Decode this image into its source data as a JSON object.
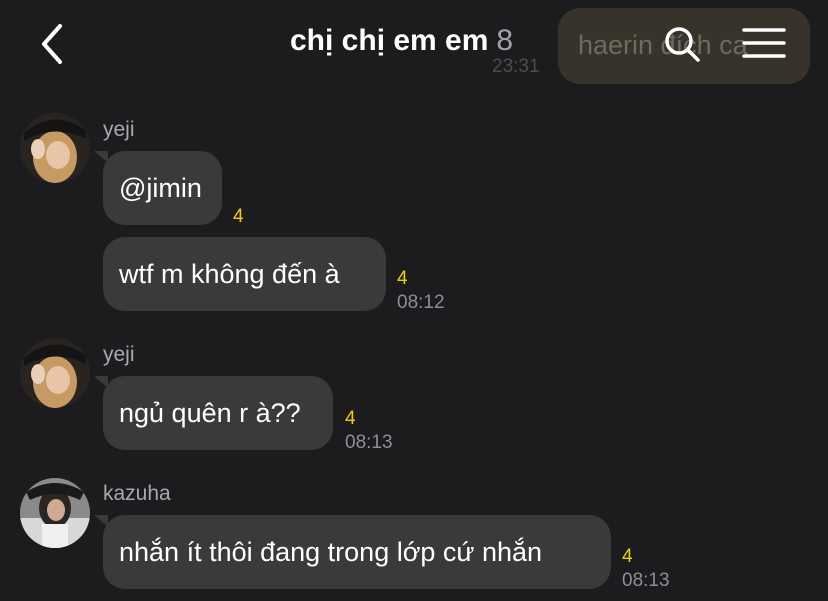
{
  "header": {
    "title": "chị chị em em",
    "member_count": "8",
    "back_icon": "chevron-left-icon",
    "search_icon": "search-icon",
    "menu_icon": "hamburger-menu-icon",
    "background_preview": {
      "text": "haerin đích ca",
      "time": "23:31"
    }
  },
  "messages": [
    {
      "sender": "yeji",
      "bubbles": [
        {
          "text": "@jimin",
          "unread": "4",
          "time": ""
        },
        {
          "text": "wtf m không đến à",
          "unread": "4",
          "time": "08:12"
        }
      ]
    },
    {
      "sender": "yeji",
      "bubbles": [
        {
          "text": "ngủ quên r à??",
          "unread": "4",
          "time": "08:13"
        }
      ]
    },
    {
      "sender": "kazuha",
      "bubbles": [
        {
          "text": "nhắn ít thôi đang trong lớp cứ nhắn",
          "unread": "4",
          "time": "08:13"
        }
      ]
    }
  ],
  "colors": {
    "background": "#1c1c1e",
    "bubble": "#3a3a3c",
    "unread_badge": "#f2d000",
    "timestamp": "#8e8e93",
    "sender_name": "#a9a9ad"
  }
}
